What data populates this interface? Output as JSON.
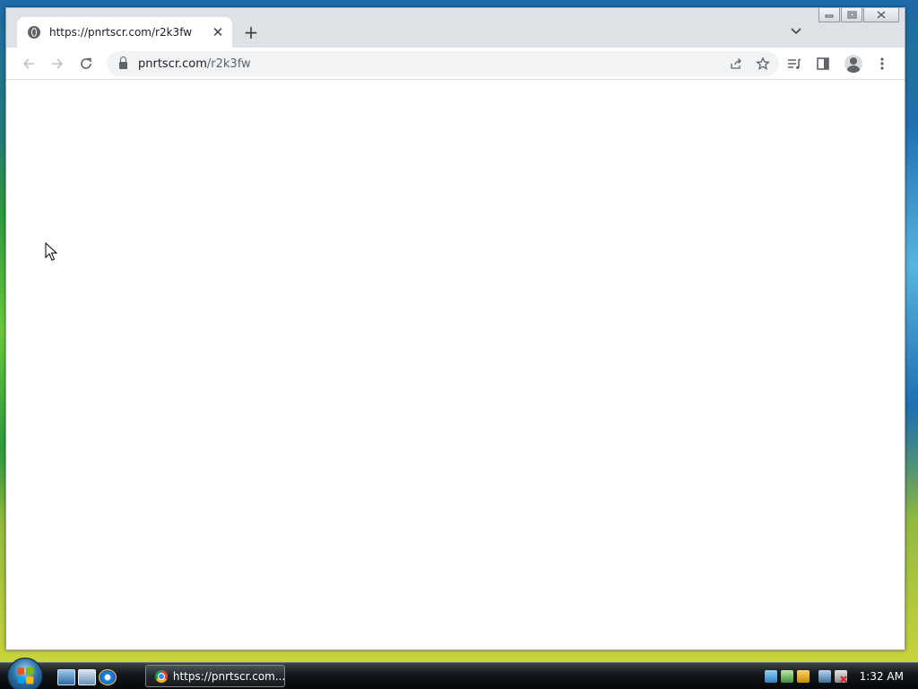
{
  "window": {
    "controls": {
      "minimize_icon": "minimize-icon",
      "maximize_icon": "maximize-icon",
      "close_icon": "close-icon"
    }
  },
  "tabs": [
    {
      "title": "https://pnrtscr.com/r2k3fw",
      "icon": "globe-icon",
      "active": true
    }
  ],
  "toolbar": {
    "url_host": "pnrtscr.com",
    "url_path": "/r2k3fw",
    "icons": [
      "back-arrow-icon",
      "forward-arrow-icon",
      "reload-icon",
      "lock-icon",
      "share-icon",
      "star-icon",
      "reading-list-icon",
      "side-panel-icon",
      "profile-avatar-icon",
      "menu-kebab-icon"
    ]
  },
  "taskbar": {
    "task_label": "https://pnrtscr.com...",
    "clock": "1:32 AM",
    "colors": {
      "taskbar_bg": "#121519",
      "accent": "#2b6fa6"
    }
  }
}
